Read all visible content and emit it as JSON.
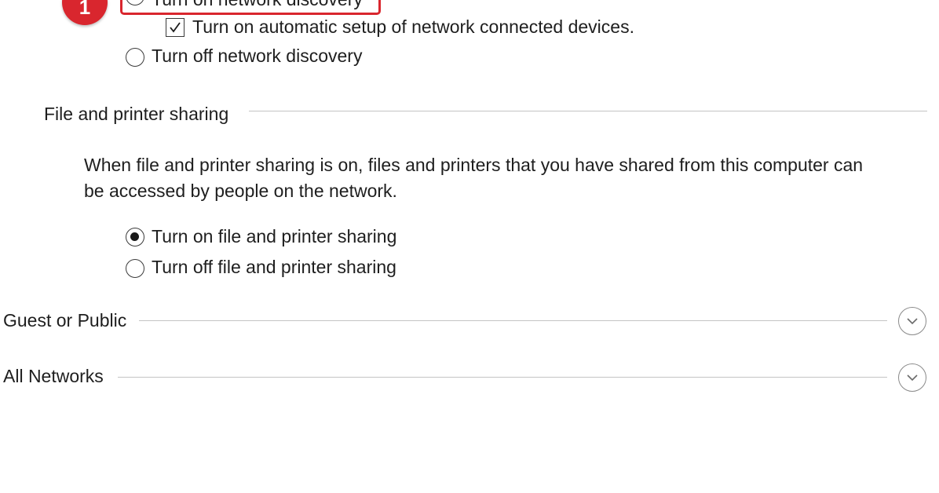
{
  "network_discovery": {
    "step_number": "1",
    "option_on_label": "Turn on network discovery",
    "auto_setup_label": "Turn on automatic setup of network connected devices.",
    "option_off_label": "Turn off network discovery"
  },
  "file_printer_sharing": {
    "heading": "File and printer sharing",
    "description_line1": "When file and printer sharing is on, files and printers that you have shared from this computer can",
    "description_line2": "be accessed by people on the network.",
    "option_on_label": "Turn on file and printer sharing",
    "option_off_label": "Turn off file and printer sharing"
  },
  "profiles": {
    "guest_public": "Guest or Public",
    "all_networks": "All Networks"
  },
  "state": {
    "network_discovery": "on",
    "auto_setup_checked": true,
    "file_printer_sharing": "on"
  },
  "colors": {
    "highlight": "#d9262e",
    "rule": "#c4c4c4"
  },
  "icons": {
    "expander": "chevron-down-icon",
    "checkmark": "checkmark-icon"
  }
}
